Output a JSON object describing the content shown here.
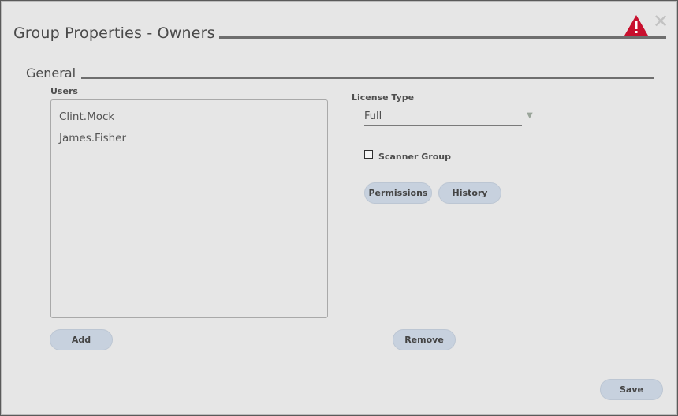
{
  "dialog": {
    "title": "Group Properties - Owners",
    "close_glyph": "✕",
    "warning_icon": "warning-triangle-icon",
    "warning_color": "#c8102e"
  },
  "general": {
    "section_title": "General",
    "users_label": "Users",
    "users": [
      "Clint.Mock",
      "James.Fisher"
    ],
    "license_type_label": "License Type",
    "license_type_value": "Full",
    "scanner_group_label": "Scanner Group",
    "scanner_group_checked": false
  },
  "buttons": {
    "permissions": "Permissions",
    "history": "History",
    "add": "Add",
    "remove": "Remove",
    "save": "Save"
  },
  "colors": {
    "button_bg": "#c7d1de",
    "dialog_bg": "#e6e6e6"
  }
}
